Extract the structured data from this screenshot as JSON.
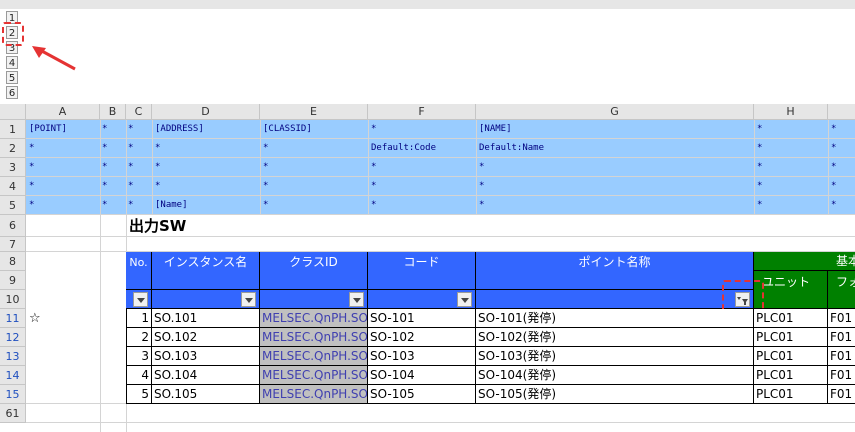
{
  "outline_levels": [
    "1",
    "2",
    "3",
    "4",
    "5",
    "6"
  ],
  "columns": [
    "A",
    "B",
    "C",
    "D",
    "E",
    "F",
    "G",
    "H"
  ],
  "rows": [
    "1",
    "2",
    "3",
    "4",
    "5",
    "6",
    "7",
    "8",
    "9",
    "10",
    "11",
    "12",
    "13",
    "14",
    "15",
    "61"
  ],
  "meta": {
    "r1": {
      "a": "[POINT]",
      "b": "*",
      "c": "*",
      "d": "[ADDRESS]",
      "e": "[CLASSID]",
      "f": "*",
      "g": "[NAME]",
      "h": "*",
      "i": "*"
    },
    "r2": {
      "a": "*",
      "b": "*",
      "c": "*",
      "d": "*",
      "e": "*",
      "f": "Default:Code",
      "g": "Default:Name",
      "h": "*",
      "i": "*"
    },
    "r3": {
      "a": "*",
      "b": "*",
      "c": "*",
      "d": "*",
      "e": "*",
      "f": "*",
      "g": "*",
      "h": "*",
      "i": "*"
    },
    "r4": {
      "a": "*",
      "b": "*",
      "c": "*",
      "d": "*",
      "e": "*",
      "f": "*",
      "g": "*",
      "h": "*",
      "i": "*"
    },
    "r5": {
      "a": "*",
      "b": "*",
      "c": "*",
      "d": "[Name]",
      "e": "*",
      "f": "*",
      "g": "*",
      "h": "*",
      "i": "*"
    }
  },
  "section_title": "出力SW",
  "headers": {
    "no": "No.",
    "instance": "インスタンス名",
    "class_id": "クラスID",
    "code": "コード",
    "point_name": "ポイント名称",
    "basic": "基本",
    "unit": "ユニット",
    "format": "フォ"
  },
  "star_marker": "☆",
  "table_rows": [
    {
      "no": "1",
      "instance": "SO.101",
      "class_id": "MELSEC.QnPH.SO",
      "code": "SO-101",
      "name": "SO-101(発停)",
      "unit": "PLC01",
      "format": "F01"
    },
    {
      "no": "2",
      "instance": "SO.102",
      "class_id": "MELSEC.QnPH.SO",
      "code": "SO-102",
      "name": "SO-102(発停)",
      "unit": "PLC01",
      "format": "F01"
    },
    {
      "no": "3",
      "instance": "SO.103",
      "class_id": "MELSEC.QnPH.SO",
      "code": "SO-103",
      "name": "SO-103(発停)",
      "unit": "PLC01",
      "format": "F01"
    },
    {
      "no": "4",
      "instance": "SO.104",
      "class_id": "MELSEC.QnPH.SO",
      "code": "SO-104",
      "name": "SO-104(発停)",
      "unit": "PLC01",
      "format": "F01"
    },
    {
      "no": "5",
      "instance": "SO.105",
      "class_id": "MELSEC.QnPH.SO",
      "code": "SO-105",
      "name": "SO-105(発停)",
      "unit": "PLC01",
      "format": "F01"
    }
  ],
  "colors": {
    "meta_band": "#99ccff",
    "header_blue": "#3366ff",
    "header_green": "#008000",
    "annotation": "#e53333"
  }
}
